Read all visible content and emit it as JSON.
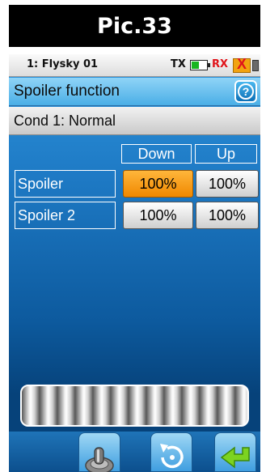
{
  "caption": "Pic.33",
  "status": {
    "model": "1: Flysky 01",
    "tx_label": "TX",
    "rx_label": "RX",
    "rx_signal_mark": "X",
    "tx_battery_level": 0.5
  },
  "header": {
    "title": "Spoiler function",
    "help_icon": "question-mark-icon",
    "help_symbol": "?"
  },
  "condition": {
    "label": "Cond 1: Normal"
  },
  "table": {
    "columns": [
      "Down",
      "Up"
    ],
    "rows": [
      {
        "label": "Spoiler",
        "down": "100%",
        "up": "100%",
        "selected": "down"
      },
      {
        "label": "Spoiler 2",
        "down": "100%",
        "up": "100%"
      }
    ]
  },
  "bottom_bar": {
    "icons": [
      "toggle-switch-icon",
      "reset-rotate-icon",
      "back-arrow-icon"
    ]
  },
  "colors": {
    "selected": "#f08800",
    "screen_background": "#1e7ac5",
    "title_bar": "#4aaee6"
  }
}
